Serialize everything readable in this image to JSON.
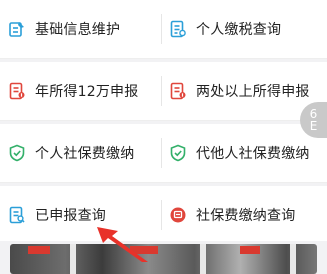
{
  "services": [
    [
      {
        "label": "基础信息维护",
        "icon": "edit-document-icon"
      },
      {
        "label": "个人缴税查询",
        "icon": "tax-document-icon"
      }
    ],
    [
      {
        "label": "年所得12万申报",
        "icon": "declaration-document-icon"
      },
      {
        "label": "两处以上所得申报",
        "icon": "declaration-document-icon"
      }
    ],
    [
      {
        "label": "个人社保费缴纳",
        "icon": "shield-icon"
      },
      {
        "label": "代他人社保费缴纳",
        "icon": "shield-icon"
      }
    ],
    [
      {
        "label": "已申报查询",
        "icon": "query-document-icon"
      },
      {
        "label": "社保费缴纳查询",
        "icon": "query-circle-icon"
      }
    ]
  ],
  "side_tab": {
    "label": "6",
    "sub": "E"
  },
  "colors": {
    "blue": "#2b9fd8",
    "red": "#e0463c",
    "green": "#33b06a",
    "text": "#222222",
    "arrow": "#e8322a"
  }
}
